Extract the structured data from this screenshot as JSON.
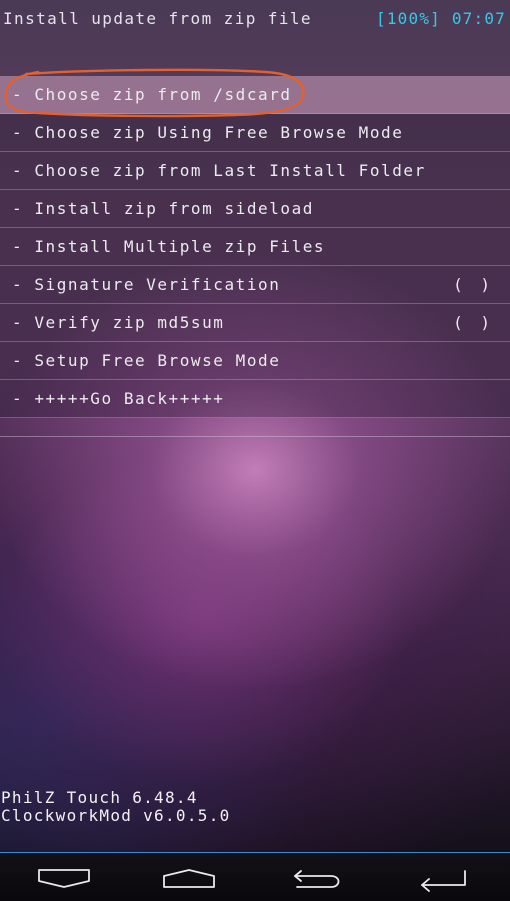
{
  "header": {
    "title": "Install update from zip file",
    "status": "[100%] 07:07"
  },
  "menu": {
    "items": [
      {
        "label": "- Choose zip from /sdcard",
        "selected": true,
        "check": ""
      },
      {
        "label": "- Choose zip Using Free Browse Mode",
        "selected": false,
        "check": ""
      },
      {
        "label": "- Choose zip from Last Install Folder",
        "selected": false,
        "check": ""
      },
      {
        "label": "- Install zip from sideload",
        "selected": false,
        "check": ""
      },
      {
        "label": "- Install Multiple zip Files",
        "selected": false,
        "check": ""
      },
      {
        "label": "- Signature Verification",
        "selected": false,
        "check": "( )"
      },
      {
        "label": "- Verify zip md5sum",
        "selected": false,
        "check": "( )"
      },
      {
        "label": "- Setup Free Browse Mode",
        "selected": false,
        "check": ""
      },
      {
        "label": "- +++++Go Back+++++",
        "selected": false,
        "check": ""
      }
    ]
  },
  "footer": {
    "line1": "PhilZ Touch 6.48.4",
    "line2": "ClockworkMod v6.0.5.0"
  },
  "nav": {
    "buttons": [
      "down-icon",
      "home-icon",
      "back-icon",
      "enter-icon"
    ]
  },
  "colors": {
    "status": "#37c8e6",
    "selection": "#cda0be",
    "annotation": "#e2612e",
    "nav_divider": "#2f8fd0"
  }
}
